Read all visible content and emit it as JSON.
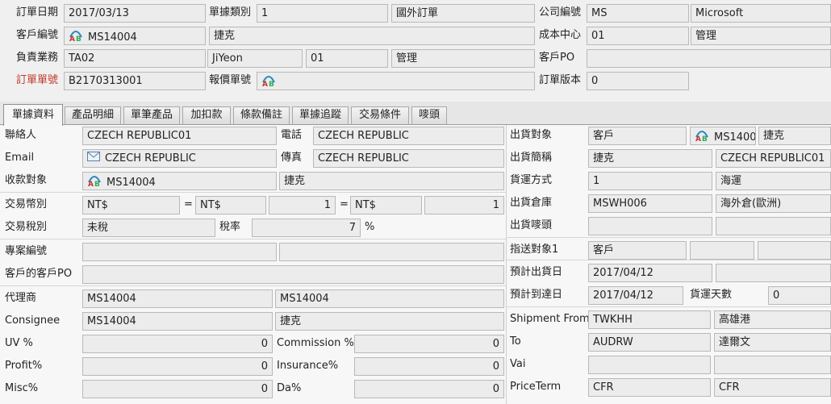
{
  "header": {
    "order_date": {
      "label": "訂單日期",
      "value": "2017/03/13"
    },
    "doc_type": {
      "label": "單據類別",
      "code": "1",
      "name": "國外訂單"
    },
    "company": {
      "label": "公司編號",
      "code": "MS",
      "name": "Microsoft"
    },
    "customer": {
      "label": "客戶編號",
      "code": "MS14004",
      "name": "捷克"
    },
    "cost_center": {
      "label": "成本中心",
      "code": "01",
      "name": "管理"
    },
    "sales_rep": {
      "label": "負責業務",
      "code": "TA02",
      "name": "JiYeon",
      "dept_code": "01",
      "dept_name": "管理"
    },
    "customer_po": {
      "label": "客戶PO",
      "value": ""
    },
    "order_no": {
      "label": "訂單單號",
      "value": "B2170313001"
    },
    "quote_no": {
      "label": "報價單號",
      "value": ""
    },
    "order_version": {
      "label": "訂單版本",
      "value": "0"
    }
  },
  "tabs": [
    {
      "label": "單據資料"
    },
    {
      "label": "產品明細"
    },
    {
      "label": "單筆產品"
    },
    {
      "label": "加扣款"
    },
    {
      "label": "條款備註"
    },
    {
      "label": "單據追蹤"
    },
    {
      "label": "交易條件"
    },
    {
      "label": "嘜頭"
    }
  ],
  "left": {
    "contact": {
      "label": "聯絡人",
      "value": "CZECH REPUBLIC01"
    },
    "phone": {
      "label": "電話",
      "value": "CZECH REPUBLIC"
    },
    "email": {
      "label": "Email",
      "value": "CZECH REPUBLIC"
    },
    "fax": {
      "label": "傳真",
      "value": "CZECH REPUBLIC"
    },
    "payee": {
      "label": "收款對象",
      "code": "MS14004",
      "name": "捷克"
    },
    "currency": {
      "label": "交易幣別",
      "cur1": "NT$",
      "eq1": "=",
      "cur2": "NT$",
      "rate1": "1",
      "eq2": "=",
      "cur3": "NT$",
      "rate2": "1"
    },
    "tax": {
      "label": "交易稅別",
      "value": "未稅",
      "rate_label": "稅率",
      "rate": "7",
      "unit": "%"
    },
    "project_no": {
      "label": "專案編號",
      "code": "",
      "name": ""
    },
    "cust_customer_po": {
      "label": "客戶的客戶PO",
      "value": ""
    },
    "agent": {
      "label": "代理商",
      "code": "MS14004",
      "name": "MS14004"
    },
    "consignee": {
      "label": "Consignee",
      "code": "MS14004",
      "name": "捷克"
    },
    "uv": {
      "label": "UV %",
      "value": "0"
    },
    "commission": {
      "label": "Commission %",
      "value": "0"
    },
    "profit": {
      "label": "Profit%",
      "value": "0"
    },
    "insurance": {
      "label": "Insurance%",
      "value": "0"
    },
    "misc": {
      "label": "Misc%",
      "value": "0"
    },
    "da": {
      "label": "Da%",
      "value": "0"
    }
  },
  "right": {
    "ship_target": {
      "label": "出貨對象",
      "type": "客戶",
      "code": "MS1400",
      "name": "捷克"
    },
    "ship_short": {
      "label": "出貨簡稱",
      "name": "捷克",
      "contact": "CZECH REPUBLIC01"
    },
    "ship_method": {
      "label": "貨運方式",
      "code": "1",
      "name": "海運"
    },
    "warehouse": {
      "label": "出貨倉庫",
      "code": "MSWH006",
      "name": "海外倉(歐洲)"
    },
    "ship_mark": {
      "label": "出貨嘜頭",
      "code": "",
      "name": ""
    },
    "deliver_to": {
      "label": "指送對象1",
      "type": "客戶",
      "code": "",
      "name": ""
    },
    "est_ship": {
      "label": "預計出貨日",
      "value": "2017/04/12"
    },
    "est_arrive": {
      "label": "預計到達日",
      "value": "2017/04/12",
      "days_label": "貨運天數",
      "days": "0"
    },
    "ship_from": {
      "label": "Shipment From",
      "code": "TWKHH",
      "name": "高雄港"
    },
    "to": {
      "label": "To",
      "code": "AUDRW",
      "name": "達爾文"
    },
    "vai": {
      "label": "Vai",
      "code": "",
      "name": ""
    },
    "price_term": {
      "label": "PriceTerm",
      "code": "CFR",
      "name": "CFR"
    }
  }
}
